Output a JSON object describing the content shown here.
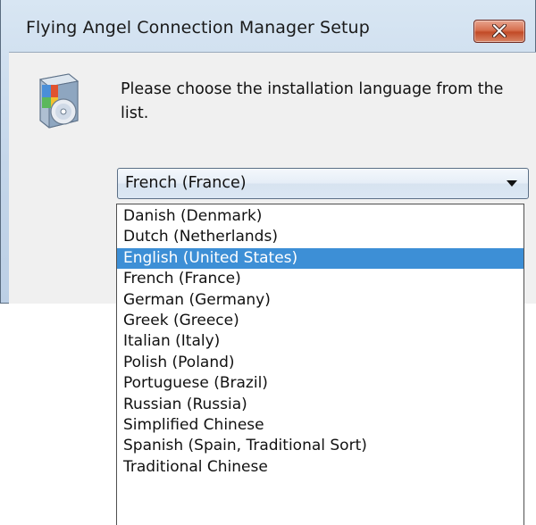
{
  "window": {
    "title": "Flying Angel Connection Manager Setup",
    "prompt": "Please choose the installation language from the list."
  },
  "language_select": {
    "value": "French (France)",
    "options": [
      "Danish (Denmark)",
      "Dutch (Netherlands)",
      "English (United States)",
      "French (France)",
      "German (Germany)",
      "Greek (Greece)",
      "Italian (Italy)",
      "Polish (Poland)",
      "Portuguese (Brazil)",
      "Russian (Russia)",
      "Simplified Chinese",
      "Spanish (Spain, Traditional Sort)",
      "Traditional Chinese"
    ],
    "highlighted": "English (United States)"
  },
  "colors": {
    "highlight": "#3d8fd6",
    "close_button": "#c24a26",
    "titlebar": "#c4d6ea"
  },
  "icons": {
    "close": "close-icon",
    "installer": "installer-icon",
    "dropdown": "chevron-down-icon"
  }
}
